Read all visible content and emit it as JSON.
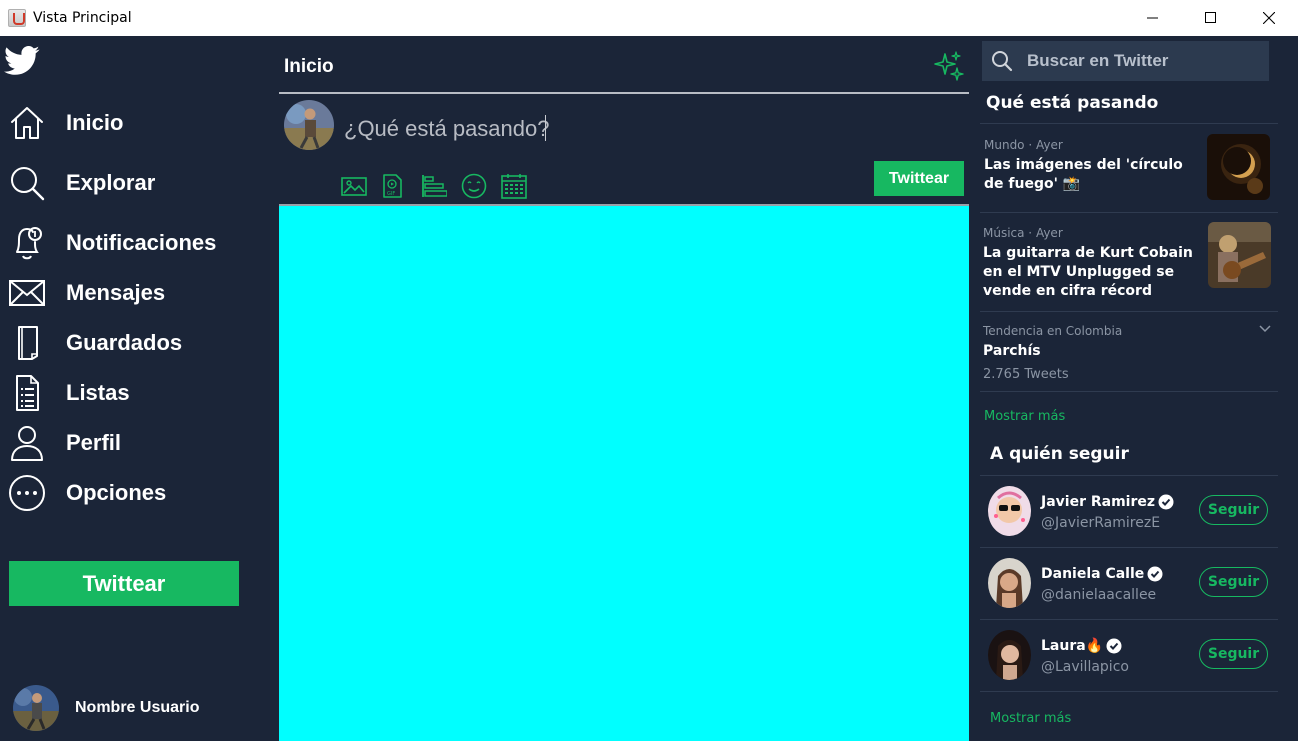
{
  "window": {
    "title": "Vista Principal"
  },
  "sidebar": {
    "items": [
      {
        "label": "Inicio",
        "icon": "home-icon"
      },
      {
        "label": "Explorar",
        "icon": "search-icon"
      },
      {
        "label": "Notificaciones",
        "icon": "bell-icon"
      },
      {
        "label": "Mensajes",
        "icon": "envelope-icon"
      },
      {
        "label": "Guardados",
        "icon": "bookmark-icon"
      },
      {
        "label": "Listas",
        "icon": "list-icon"
      },
      {
        "label": "Perfil",
        "icon": "user-icon"
      },
      {
        "label": "Opciones",
        "icon": "more-icon"
      }
    ],
    "tweet_button": "Twittear",
    "user_name": "Nombre Usuario"
  },
  "main": {
    "title": "Inicio",
    "composer_prompt": "¿Qué está pasando?",
    "tweet_button": "Twittear",
    "tools": [
      "image-icon",
      "gif-icon",
      "poll-icon",
      "emoji-icon",
      "schedule-icon"
    ]
  },
  "right": {
    "search_placeholder": "Buscar en Twitter",
    "trends_title": "Qué está pasando",
    "trends": [
      {
        "meta": "Mundo · Ayer",
        "headline": "Las imágenes del 'círculo de fuego' 📸"
      },
      {
        "meta": "Música · Ayer",
        "headline": "La guitarra de Kurt Cobain en el MTV Unplugged se vende en cifra récord"
      },
      {
        "meta": "Tendencia en Colombia",
        "headline": "Parchís",
        "count": "2.765 Tweets"
      }
    ],
    "trends_more": "Mostrar más",
    "follow_title": "A quién seguir",
    "follow": [
      {
        "name": "Javier Ramirez",
        "handle": "@JavierRamirezE",
        "button": "Seguir"
      },
      {
        "name": "Daniela Calle",
        "handle": "@danielaacallee",
        "button": "Seguir"
      },
      {
        "name": "Laura🔥",
        "handle": "@Lavillapico",
        "button": "Seguir"
      }
    ],
    "follow_more": "Mostrar más"
  },
  "colors": {
    "background": "#1b2538",
    "accent": "#17b861",
    "feed": "#00ffff",
    "search_bg": "#2c3a4f"
  }
}
